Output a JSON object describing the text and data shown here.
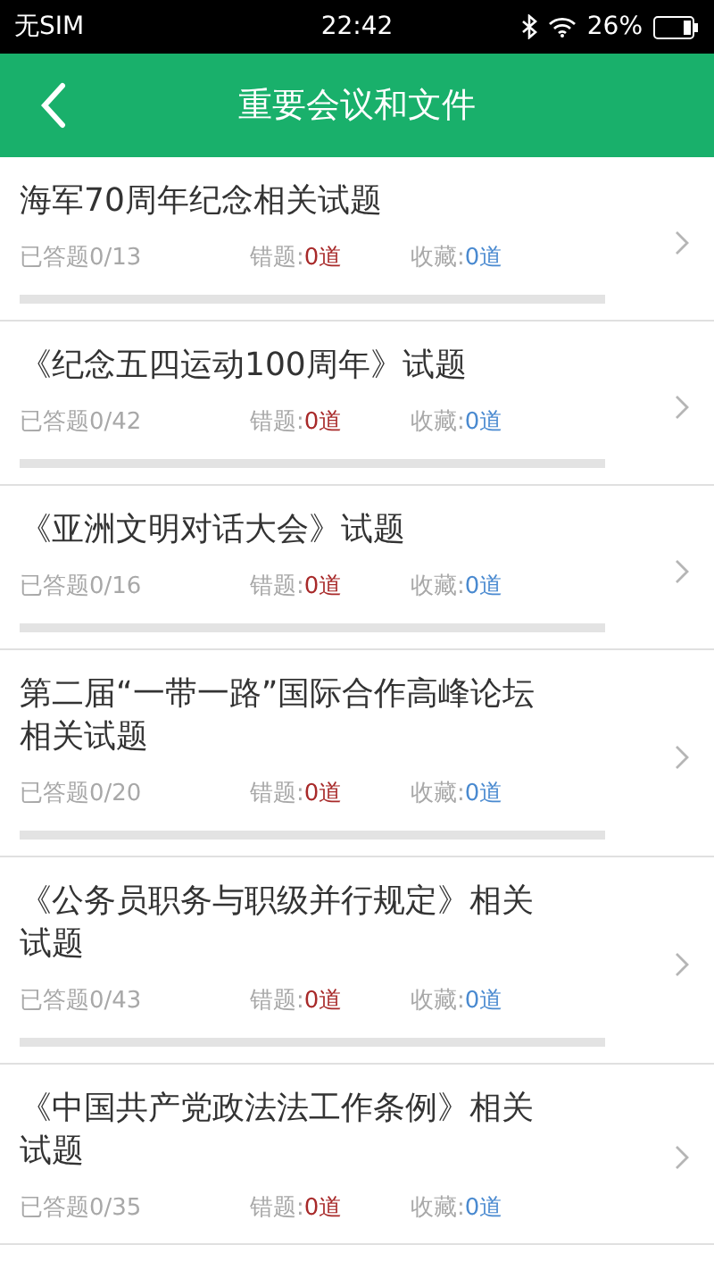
{
  "status_bar": {
    "carrier": "无SIM",
    "time": "22:42",
    "battery": "26%"
  },
  "header": {
    "title": "重要会议和文件"
  },
  "items": [
    {
      "title": "海军70周年纪念相关试题",
      "answered": "已答题0/13",
      "wrong_label": "错题:",
      "wrong": "0道",
      "fav_label": "收藏:",
      "fav": "0道",
      "level": 0
    },
    {
      "title": "《纪念五四运动100周年》试题",
      "answered": "已答题0/42",
      "wrong_label": "错题:",
      "wrong": "0道",
      "fav_label": "收藏:",
      "fav": "0道",
      "level": 0
    },
    {
      "title": "《亚洲文明对话大会》试题",
      "answered": "已答题0/16",
      "wrong_label": "错题:",
      "wrong": "0道",
      "fav_label": "收藏:",
      "fav": "0道",
      "level": 0
    },
    {
      "title": "第二届“一带一路”国际合作高峰论坛相关试题",
      "answered": "已答题0/20",
      "wrong_label": "错题:",
      "wrong": "0道",
      "fav_label": "收藏:",
      "fav": "0道",
      "level": 0
    },
    {
      "title": "《公务员职务与职级并行规定》相关试题",
      "answered": "已答题0/43",
      "wrong_label": "错题:",
      "wrong": "0道",
      "fav_label": "收藏:",
      "fav": "0道",
      "level": 0
    },
    {
      "title": "《中国共产党政法法工作条例》相关试题",
      "answered": "已答题0/35",
      "wrong_label": "错题:",
      "wrong": "0道",
      "fav_label": "收藏:",
      "fav": "0道"
    }
  ]
}
